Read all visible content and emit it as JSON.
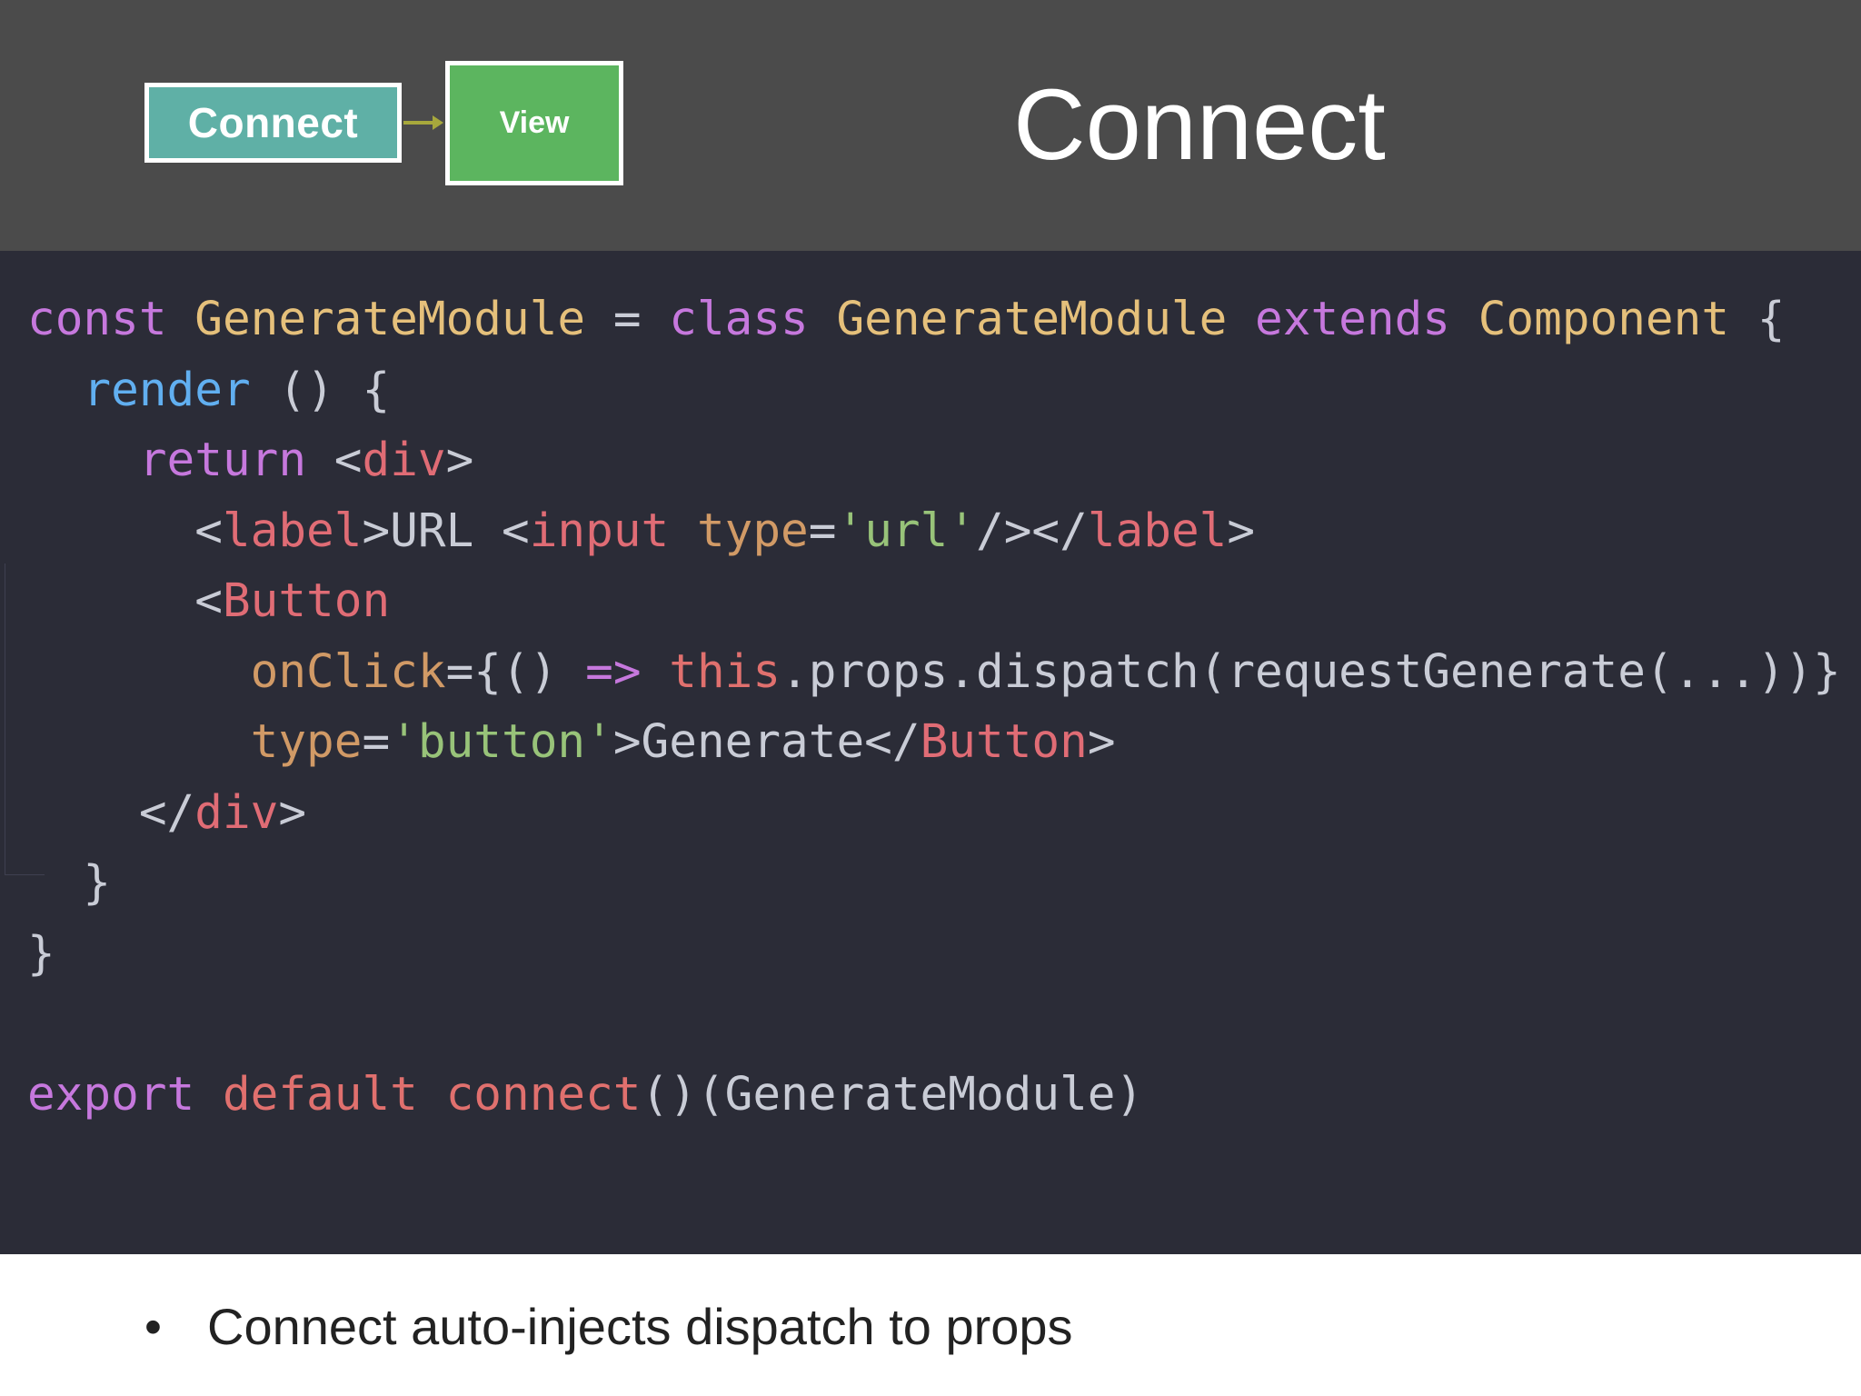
{
  "header": {
    "flow": {
      "source_label": "Connect",
      "target_label": "View"
    },
    "title": "Connect"
  },
  "code": {
    "lines": [
      [
        {
          "text": "const ",
          "kind": "keyword"
        },
        {
          "text": "GenerateModule",
          "kind": "type"
        },
        {
          "text": " = ",
          "kind": "plain"
        },
        {
          "text": "class ",
          "kind": "keyword"
        },
        {
          "text": "GenerateModule ",
          "kind": "type"
        },
        {
          "text": "extends ",
          "kind": "keyword"
        },
        {
          "text": "Component",
          "kind": "type"
        },
        {
          "text": " {",
          "kind": "plain"
        }
      ],
      [
        {
          "text": "  ",
          "kind": "plain"
        },
        {
          "text": "render",
          "kind": "method"
        },
        {
          "text": " () {",
          "kind": "plain"
        }
      ],
      [
        {
          "text": "    ",
          "kind": "plain"
        },
        {
          "text": "return ",
          "kind": "keyword"
        },
        {
          "text": "<",
          "kind": "plain"
        },
        {
          "text": "div",
          "kind": "tag"
        },
        {
          "text": ">",
          "kind": "plain"
        }
      ],
      [
        {
          "text": "      <",
          "kind": "plain"
        },
        {
          "text": "label",
          "kind": "tag"
        },
        {
          "text": ">URL <",
          "kind": "plain"
        },
        {
          "text": "input ",
          "kind": "tag"
        },
        {
          "text": "type",
          "kind": "attr"
        },
        {
          "text": "=",
          "kind": "plain"
        },
        {
          "text": "'url'",
          "kind": "string"
        },
        {
          "text": "/></",
          "kind": "plain"
        },
        {
          "text": "label",
          "kind": "tag"
        },
        {
          "text": ">",
          "kind": "plain"
        }
      ],
      [
        {
          "text": "      <",
          "kind": "plain"
        },
        {
          "text": "Button",
          "kind": "tag"
        }
      ],
      [
        {
          "text": "        ",
          "kind": "plain"
        },
        {
          "text": "onClick",
          "kind": "attr"
        },
        {
          "text": "={() ",
          "kind": "plain"
        },
        {
          "text": "=> ",
          "kind": "keyword"
        },
        {
          "text": "this",
          "kind": "function"
        },
        {
          "text": ".props.dispatch(requestGenerate(...))}",
          "kind": "plain"
        }
      ],
      [
        {
          "text": "        ",
          "kind": "plain"
        },
        {
          "text": "type",
          "kind": "attr"
        },
        {
          "text": "=",
          "kind": "plain"
        },
        {
          "text": "'button'",
          "kind": "string"
        },
        {
          "text": ">Generate</",
          "kind": "plain"
        },
        {
          "text": "Button",
          "kind": "tag"
        },
        {
          "text": ">",
          "kind": "plain"
        }
      ],
      [
        {
          "text": "    </",
          "kind": "plain"
        },
        {
          "text": "div",
          "kind": "tag"
        },
        {
          "text": ">",
          "kind": "plain"
        }
      ],
      [
        {
          "text": "  }",
          "kind": "plain"
        }
      ],
      [
        {
          "text": "}",
          "kind": "plain"
        }
      ],
      [],
      [
        {
          "text": "export ",
          "kind": "keyword"
        },
        {
          "text": "default ",
          "kind": "function"
        },
        {
          "text": "connect",
          "kind": "function"
        },
        {
          "text": "()(GenerateModule)",
          "kind": "plain"
        }
      ]
    ]
  },
  "bullets": [
    {
      "marker": "•",
      "text": "Connect auto-injects dispatch to props"
    }
  ],
  "colors": {
    "header_bg": "#4b4b4b",
    "code_bg": "#2b2c37",
    "connect_box": "#5fb0a6",
    "view_box": "#5cb55f",
    "arrow": "#a7a83c"
  }
}
